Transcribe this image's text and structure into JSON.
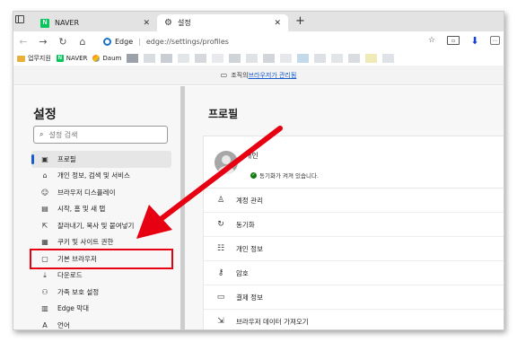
{
  "tabs": [
    {
      "title": "NAVER",
      "favicon": "N"
    },
    {
      "title": "설정"
    }
  ],
  "toolbar": {
    "browser_label": "Edge",
    "url": "edge://settings/profiles"
  },
  "bookmarks": {
    "items": [
      {
        "label": "업무지원"
      },
      {
        "label": "NAVER",
        "favicon": "N"
      },
      {
        "label": "Daum"
      }
    ]
  },
  "managed_banner": {
    "prefix": "조직의 ",
    "link": "브라우저가 관리됨"
  },
  "sidebar": {
    "title": "설정",
    "search_placeholder": "설정 검색",
    "items": [
      {
        "label": "프로필",
        "icon": "profile-icon"
      },
      {
        "label": "개인 정보, 검색 및 서비스",
        "icon": "lock-icon"
      },
      {
        "label": "브라우저 디스플레이",
        "icon": "palette-icon"
      },
      {
        "label": "시작, 홈 및 새 탭",
        "icon": "home-icon"
      },
      {
        "label": "잘라내기, 복사 및 붙여넣기",
        "icon": "share-icon"
      },
      {
        "label": "쿠키 및 사이트 권한",
        "icon": "cookie-icon"
      },
      {
        "label": "기본 브라우저",
        "icon": "browser-icon"
      },
      {
        "label": "다운로드",
        "icon": "download-icon"
      },
      {
        "label": "가족 보호 설정",
        "icon": "family-icon"
      },
      {
        "label": "Edge 막대",
        "icon": "edge-bar-icon"
      },
      {
        "label": "언어",
        "icon": "language-icon"
      }
    ]
  },
  "main": {
    "title": "프로필",
    "profile_name": "개인",
    "sync_status": "동기화가 켜져 있습니다.",
    "rows": [
      {
        "label": "계정 관리",
        "icon": "account-icon"
      },
      {
        "label": "동기화",
        "icon": "sync-icon"
      },
      {
        "label": "개인 정보",
        "icon": "personal-info-icon"
      },
      {
        "label": "암호",
        "icon": "key-icon"
      },
      {
        "label": "결제 정보",
        "icon": "card-icon"
      },
      {
        "label": "브라우저 데이터 가져오기",
        "icon": "import-icon"
      }
    ]
  },
  "colors": {
    "accent": "#1a5ccc",
    "highlight_box": "#e60012",
    "arrow": "#e60012",
    "naver_green": "#03c75a"
  }
}
